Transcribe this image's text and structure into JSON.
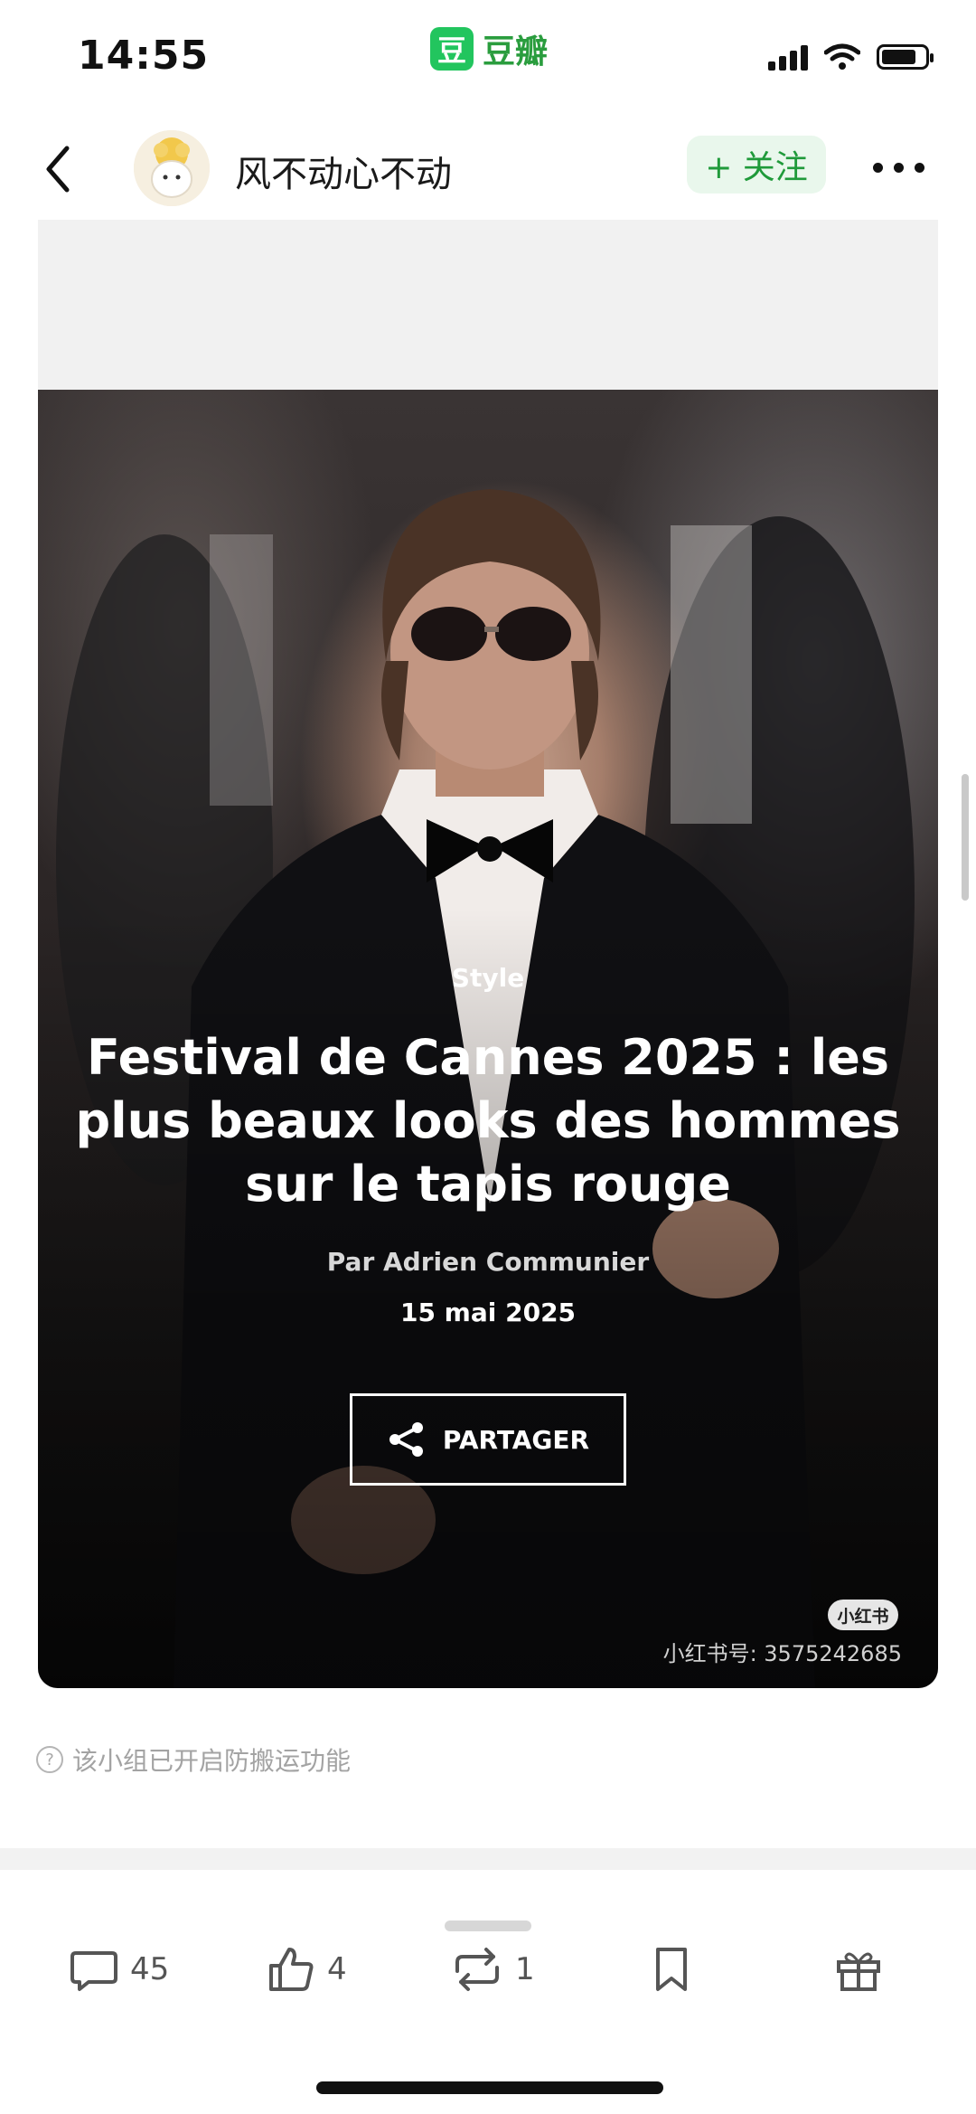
{
  "status_bar": {
    "time": "14:55",
    "app_logo_char": "豆",
    "app_name": "豆瓣",
    "battery_level": 0.8
  },
  "header": {
    "username": "风不动心不动",
    "follow_label": "+ 关注"
  },
  "post": {
    "kicker": "Style",
    "headline": "Festival de Cannes 2025 : les plus beaux looks des hommes sur le tapis rouge",
    "byline": "Par Adrien Communier",
    "date": "15 mai 2025",
    "share_label": "PARTAGER",
    "watermark_badge": "小红书",
    "watermark_id": "小红书号: 3575242685"
  },
  "notice": {
    "icon": "?",
    "text": "该小组已开启防搬运功能"
  },
  "actions": {
    "comments": "45",
    "likes": "4",
    "reposts": "1"
  },
  "colors": {
    "accent_green": "#22c55e",
    "follow_bg": "#e9f7ec",
    "follow_text": "#1f9a3a"
  }
}
